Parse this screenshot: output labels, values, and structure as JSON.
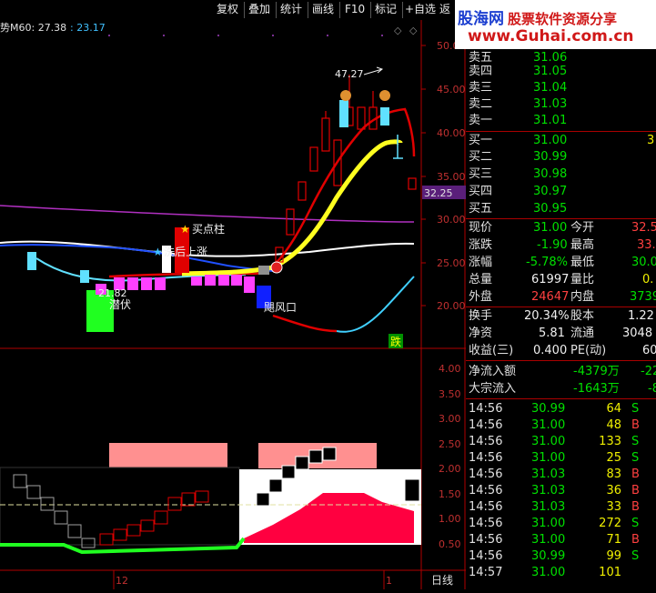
{
  "menu": {
    "items": [
      "复权",
      "叠加",
      "统计",
      "画线",
      "F10",
      "标记",
      "+自选",
      "返"
    ]
  },
  "watermark": {
    "site": "股海网",
    "slogan": "股票软件资源分享",
    "url": "www.Guhai.com.cn"
  },
  "chart": {
    "indicator_title": "势M60: 27.38",
    "indicator_value2": ": 23.17",
    "price_axis": [
      "50.00",
      "45.00",
      "40.00",
      "35.00",
      "30.00",
      "25.00",
      "20.00"
    ],
    "current_price_tag": "32.25",
    "lower_axis": [
      "4.00",
      "3.50",
      "3.00",
      "2.50",
      "2.00",
      "1.50",
      "1.00",
      "0.50"
    ],
    "annotations": {
      "high_label": "47.27",
      "low_label": "21.82",
      "buy_pillar": "买点柱",
      "wash_label": "洗后上涨",
      "ambush": "潜伏",
      "tornado": "飓风口",
      "fall": "跌"
    },
    "date_label": "12",
    "date_label2": "1",
    "period_label": "日线"
  },
  "quote": {
    "sell": [
      {
        "label": "卖五",
        "price": "31.06"
      },
      {
        "label": "卖四",
        "price": "31.05"
      },
      {
        "label": "卖三",
        "price": "31.04"
      },
      {
        "label": "卖二",
        "price": "31.03"
      },
      {
        "label": "卖一",
        "price": "31.01"
      }
    ],
    "buy": [
      {
        "label": "买一",
        "price": "31.00",
        "vol": "3"
      },
      {
        "label": "买二",
        "price": "30.99",
        "vol": ""
      },
      {
        "label": "买三",
        "price": "30.98",
        "vol": ""
      },
      {
        "label": "买四",
        "price": "30.97",
        "vol": ""
      },
      {
        "label": "买五",
        "price": "30.95",
        "vol": ""
      }
    ],
    "stats": [
      {
        "l1": "现价",
        "v1": "31.00",
        "c1": "green",
        "l2": "今开",
        "v2": "32.5",
        "c2": "red"
      },
      {
        "l1": "涨跌",
        "v1": "-1.90",
        "c1": "green",
        "l2": "最高",
        "v2": "33.",
        "c2": "red"
      },
      {
        "l1": "涨幅",
        "v1": "-5.78%",
        "c1": "green",
        "l2": "最低",
        "v2": "30.0",
        "c2": "green"
      },
      {
        "l1": "总量",
        "v1": "61997",
        "c1": "white",
        "l2": "量比",
        "v2": "0.",
        "c2": "yellow"
      },
      {
        "l1": "外盘",
        "v1": "24647",
        "c1": "red",
        "l2": "内盘",
        "v2": "3739",
        "c2": "green"
      }
    ],
    "stats2": [
      {
        "l1": "换手",
        "v1": "20.34%",
        "c1": "white",
        "l2": "股本",
        "v2": "1.22",
        "c2": "white"
      },
      {
        "l1": "净资",
        "v1": "5.81",
        "c1": "white",
        "l2": "流通",
        "v2": "3048",
        "c2": "white"
      },
      {
        "l1": "收益(三)",
        "v1": "0.400",
        "c1": "white",
        "l2": "PE(动)",
        "v2": "60",
        "c2": "white"
      }
    ],
    "flow": [
      {
        "label": "净流入额",
        "value": "-4379万",
        "extra": "-22"
      },
      {
        "label": "大宗流入",
        "value": "-1643万",
        "extra": "-8"
      }
    ],
    "ticks": [
      {
        "time": "14:56",
        "price": "30.99",
        "pc": "green",
        "vol": "64",
        "vc": "yellow",
        "side": "S",
        "sc": "green"
      },
      {
        "time": "14:56",
        "price": "31.00",
        "pc": "green",
        "vol": "48",
        "vc": "yellow",
        "side": "B",
        "sc": "red"
      },
      {
        "time": "14:56",
        "price": "31.00",
        "pc": "green",
        "vol": "133",
        "vc": "yellow",
        "side": "S",
        "sc": "green"
      },
      {
        "time": "14:56",
        "price": "31.00",
        "pc": "green",
        "vol": "25",
        "vc": "yellow",
        "side": "S",
        "sc": "green"
      },
      {
        "time": "14:56",
        "price": "31.03",
        "pc": "green",
        "vol": "83",
        "vc": "yellow",
        "side": "B",
        "sc": "red"
      },
      {
        "time": "14:56",
        "price": "31.03",
        "pc": "green",
        "vol": "36",
        "vc": "yellow",
        "side": "B",
        "sc": "red"
      },
      {
        "time": "14:56",
        "price": "31.03",
        "pc": "green",
        "vol": "33",
        "vc": "yellow",
        "side": "B",
        "sc": "red"
      },
      {
        "time": "14:56",
        "price": "31.00",
        "pc": "green",
        "vol": "272",
        "vc": "yellow",
        "side": "S",
        "sc": "green"
      },
      {
        "time": "14:56",
        "price": "31.00",
        "pc": "green",
        "vol": "71",
        "vc": "yellow",
        "side": "B",
        "sc": "red"
      },
      {
        "time": "14:56",
        "price": "30.99",
        "pc": "green",
        "vol": "99",
        "vc": "yellow",
        "side": "S",
        "sc": "green"
      },
      {
        "time": "14:57",
        "price": "31.00",
        "pc": "green",
        "vol": "101",
        "vc": "yellow",
        "side": "",
        "sc": "white"
      }
    ]
  }
}
